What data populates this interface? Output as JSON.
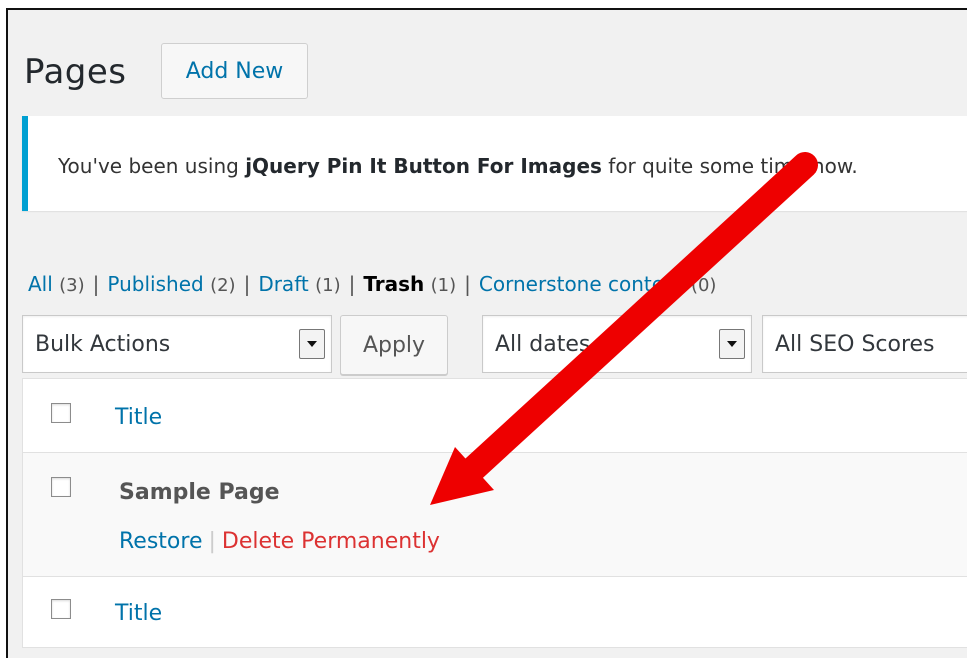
{
  "header": {
    "title": "Pages",
    "add_new_label": "Add New"
  },
  "notice": {
    "prefix": "You've been using ",
    "plugin_name": "jQuery Pin It Button For Images",
    "suffix": " for quite some time now."
  },
  "filters": {
    "views": [
      {
        "label": "All",
        "count": "(3)"
      },
      {
        "label": "Published",
        "count": "(2)"
      },
      {
        "label": "Draft",
        "count": "(1)"
      },
      {
        "label": "Trash",
        "count": "(1)",
        "current": true
      },
      {
        "label": "Cornerstone content",
        "count": "(0)"
      }
    ],
    "bulk_actions": "Bulk Actions",
    "apply_label": "Apply",
    "dates": "All dates",
    "seo_scores": "All SEO Scores"
  },
  "table": {
    "header_title": "Title",
    "footer_title": "Title",
    "rows": [
      {
        "name": "Sample Page",
        "restore_label": "Restore",
        "delete_label": "Delete Permanently"
      }
    ]
  },
  "colors": {
    "link": "#0073aa",
    "delete": "#dc3232",
    "notice_accent": "#00a0d2",
    "annotation_arrow": "#ee0000"
  },
  "annotation": {
    "icon": "red-arrow-icon"
  }
}
